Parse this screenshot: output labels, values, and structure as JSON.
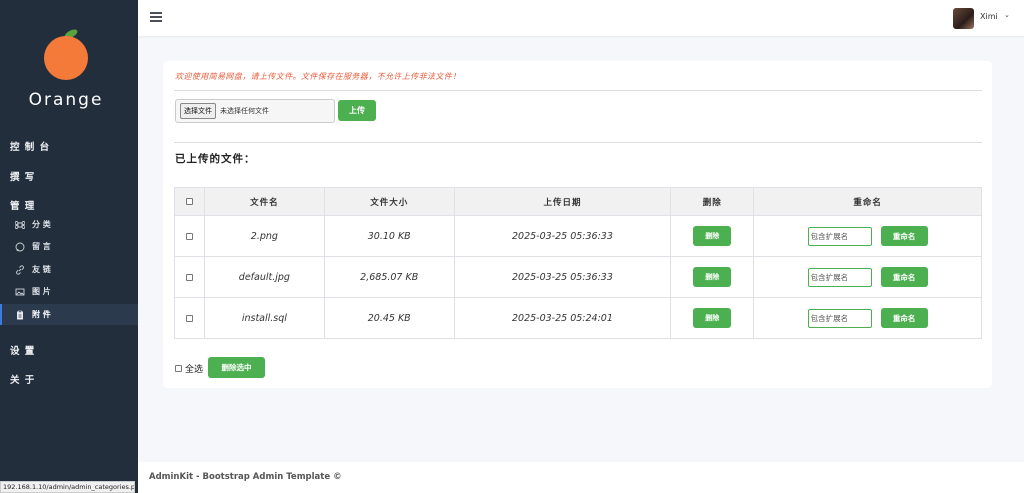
{
  "brand": {
    "name": "Orange",
    "accent": "#f47a3a",
    "leaf": "#5aa33c"
  },
  "sidebar": {
    "sections": [
      {
        "label": "控 制 台"
      },
      {
        "label": "撰 写"
      },
      {
        "label": "管 理"
      },
      {
        "label": "设 置"
      },
      {
        "label": "关 于"
      }
    ],
    "items": [
      {
        "label": "分 类",
        "icon": "command-icon"
      },
      {
        "label": "留 言",
        "icon": "message-icon"
      },
      {
        "label": "友 链",
        "icon": "link-icon"
      },
      {
        "label": "图 片",
        "icon": "image-icon"
      },
      {
        "label": "附 件",
        "icon": "clipboard-icon",
        "active": true
      }
    ]
  },
  "header": {
    "username": "Ximi",
    "caret": "⌄"
  },
  "main": {
    "welcome": "欢迎使用简易网盘，请上传文件。文件保存在服务器，不允许上传非法文件！",
    "file_input": {
      "button": "选择文件",
      "status": "未选择任何文件"
    },
    "upload_label": "上传",
    "uploaded_title": "已上传的文件：",
    "table": {
      "headers": [
        "文件名",
        "文件大小",
        "上传日期",
        "删除",
        "重命名"
      ],
      "rows": [
        {
          "name": "2.png",
          "size": "30.10 KB",
          "date": "2025-03-25 05:36:33"
        },
        {
          "name": "default.jpg",
          "size": "2,685.07 KB",
          "date": "2025-03-25 05:36:33"
        },
        {
          "name": "install.sql",
          "size": "20.45 KB",
          "date": "2025-03-25 05:24:01"
        }
      ],
      "delete_label": "删除",
      "rename_placeholder": "包含扩展名",
      "rename_label": "重命名"
    },
    "select_all_label": "全选",
    "delete_selected_label": "删除选中"
  },
  "footer": {
    "text": "AdminKit - Bootstrap Admin Template ©"
  },
  "status_url": "192.168.1.10/admin/admin_categories.php",
  "colors": {
    "sidebar": "#222e3c",
    "button": "#4caf50",
    "welcome": "#e85c3c"
  }
}
